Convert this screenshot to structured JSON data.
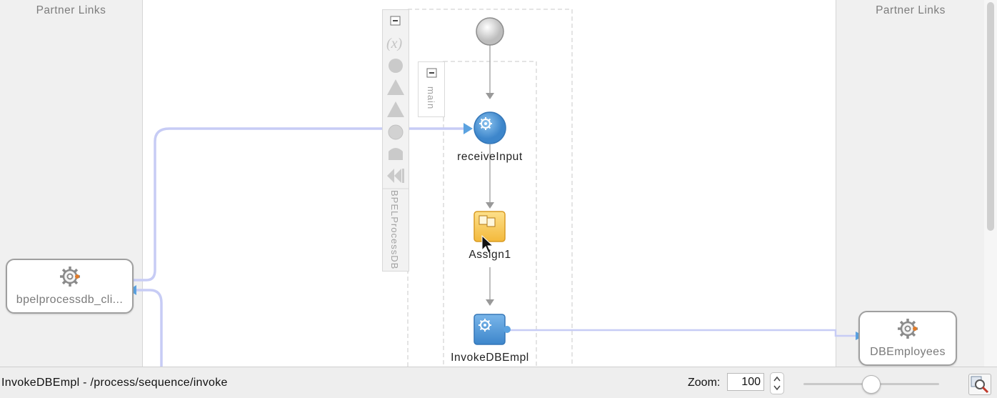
{
  "left_panel": {
    "title": "Partner Links",
    "partner": {
      "label": "bpelprocessdb_cli...",
      "icon": "gear-icon"
    }
  },
  "right_panel": {
    "title": "Partner Links",
    "partner": {
      "label": "DBEmployees",
      "icon": "gear-icon"
    }
  },
  "scope": {
    "name": "BPELProcessDB",
    "tools": [
      "collapse-icon",
      "variables-icon",
      "correlation-icon",
      "fault-handlers-icon",
      "compensation-icon",
      "event-handlers-icon",
      "termination-icon",
      "rewind-icon"
    ]
  },
  "sequence": {
    "name": "main"
  },
  "activities": [
    {
      "label": "receiveInput",
      "type": "receive",
      "icon": "gear-icon"
    },
    {
      "label": "Assign1",
      "type": "assign",
      "icon": "assign-icon"
    },
    {
      "label": "InvokeDBEmpl",
      "type": "invoke",
      "icon": "gear-icon"
    }
  ],
  "colors": {
    "link": "#c7ccf5",
    "arrow": "#5ba2e0",
    "activity_blue": "#4e97d6",
    "assign_yellow": "#f6c64a"
  },
  "status": {
    "path": "InvokeDBEmpl - /process/sequence/invoke"
  },
  "zoom": {
    "label": "Zoom:",
    "value": "100",
    "slider_fraction": 0.47
  }
}
